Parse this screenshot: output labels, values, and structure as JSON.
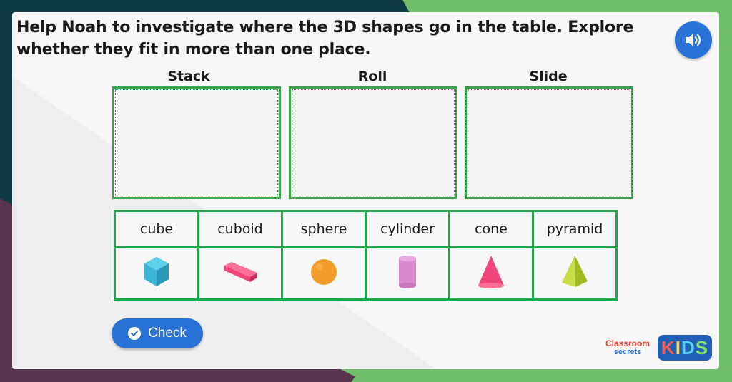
{
  "question": "Help Noah to investigate where the 3D shapes go in the table. Explore whether they fit in more than one place.",
  "columns": [
    {
      "label": "Stack"
    },
    {
      "label": "Roll"
    },
    {
      "label": "Slide"
    }
  ],
  "shapes": [
    {
      "name": "cube",
      "icon": "cube-icon",
      "color": "#3bb6d6"
    },
    {
      "name": "cuboid",
      "icon": "cuboid-icon",
      "color": "#f0457a"
    },
    {
      "name": "sphere",
      "icon": "sphere-icon",
      "color": "#f39c2a"
    },
    {
      "name": "cylinder",
      "icon": "cylinder-icon",
      "color": "#d98ad0"
    },
    {
      "name": "cone",
      "icon": "cone-icon",
      "color": "#f0457a"
    },
    {
      "name": "pyramid",
      "icon": "pyramid-icon",
      "color": "#b5cf2e"
    }
  ],
  "check_button": {
    "label": "Check"
  },
  "brand": {
    "classroom_line1": "Classroom",
    "classroom_line2": "secrets",
    "kids": [
      "K",
      "I",
      "D",
      "S"
    ]
  },
  "colors": {
    "accent_blue": "#2a73d6",
    "table_green": "#1da84a",
    "drop_border": "#3aa04a"
  }
}
